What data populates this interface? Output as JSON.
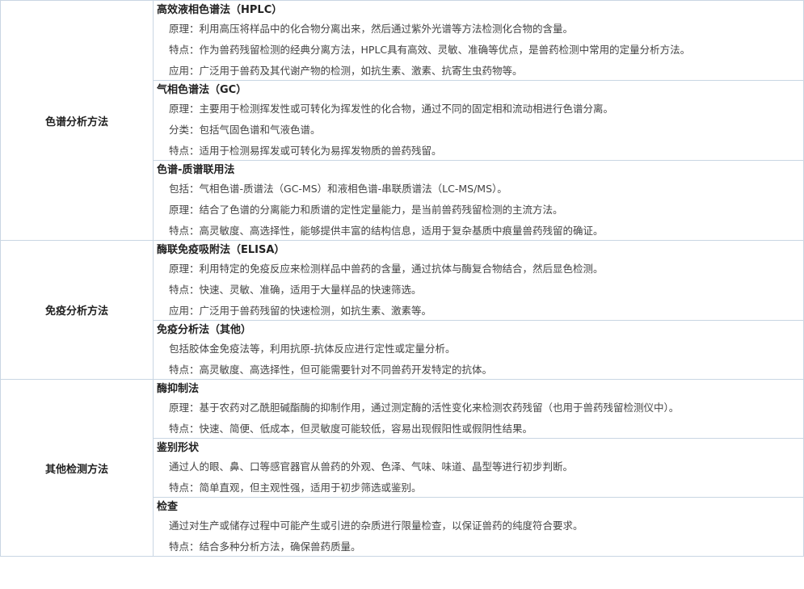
{
  "categories": [
    {
      "name": "色谱分析方法",
      "methods": [
        {
          "title": "高效液相色谱法（HPLC）",
          "lines": [
            "原理：利用高压将样品中的化合物分离出来，然后通过紫外光谱等方法检测化合物的含量。",
            "特点：作为兽药残留检测的经典分离方法，HPLC具有高效、灵敏、准确等优点，是兽药检测中常用的定量分析方法。",
            "应用：广泛用于兽药及其代谢产物的检测，如抗生素、激素、抗寄生虫药物等。"
          ]
        },
        {
          "title": "气相色谱法（GC）",
          "lines": [
            "原理：主要用于检测挥发性或可转化为挥发性的化合物，通过不同的固定相和流动相进行色谱分离。",
            "分类：包括气固色谱和气液色谱。",
            "特点：适用于检测易挥发或可转化为易挥发物质的兽药残留。"
          ]
        },
        {
          "title": "色谱-质谱联用法",
          "lines": [
            "包括：气相色谱-质谱法（GC-MS）和液相色谱-串联质谱法（LC-MS/MS）。",
            "原理：结合了色谱的分离能力和质谱的定性定量能力，是当前兽药残留检测的主流方法。",
            "特点：高灵敏度、高选择性，能够提供丰富的结构信息，适用于复杂基质中痕量兽药残留的确证。"
          ]
        }
      ]
    },
    {
      "name": "免疫分析方法",
      "methods": [
        {
          "title": "酶联免疫吸附法（ELISA）",
          "lines": [
            "原理：利用特定的免疫反应来检测样品中兽药的含量，通过抗体与酶复合物结合，然后显色检测。",
            "特点：快速、灵敏、准确，适用于大量样品的快速筛选。",
            "应用：广泛用于兽药残留的快速检测，如抗生素、激素等。"
          ]
        },
        {
          "title": "免疫分析法（其他）",
          "lines": [
            "包括胶体金免疫法等，利用抗原-抗体反应进行定性或定量分析。",
            "特点：高灵敏度、高选择性，但可能需要针对不同兽药开发特定的抗体。"
          ]
        }
      ]
    },
    {
      "name": "其他检测方法",
      "methods": [
        {
          "title": "酶抑制法",
          "lines": [
            "原理：基于农药对乙酰胆碱酯酶的抑制作用，通过测定酶的活性变化来检测农药残留（也用于兽药残留检测仪中）。",
            "特点：快速、简便、低成本，但灵敏度可能较低，容易出现假阳性或假阴性结果。"
          ]
        },
        {
          "title": "鉴别形状",
          "lines": [
            "通过人的眼、鼻、口等感官器官从兽药的外观、色泽、气味、味道、晶型等进行初步判断。",
            "特点：简单直观，但主观性强，适用于初步筛选或鉴别。"
          ]
        },
        {
          "title": "检查",
          "lines": [
            "通过对生产或储存过程中可能产生或引进的杂质进行限量检查，以保证兽药的纯度符合要求。",
            "特点：结合多种分析方法，确保兽药质量。"
          ]
        }
      ]
    }
  ]
}
